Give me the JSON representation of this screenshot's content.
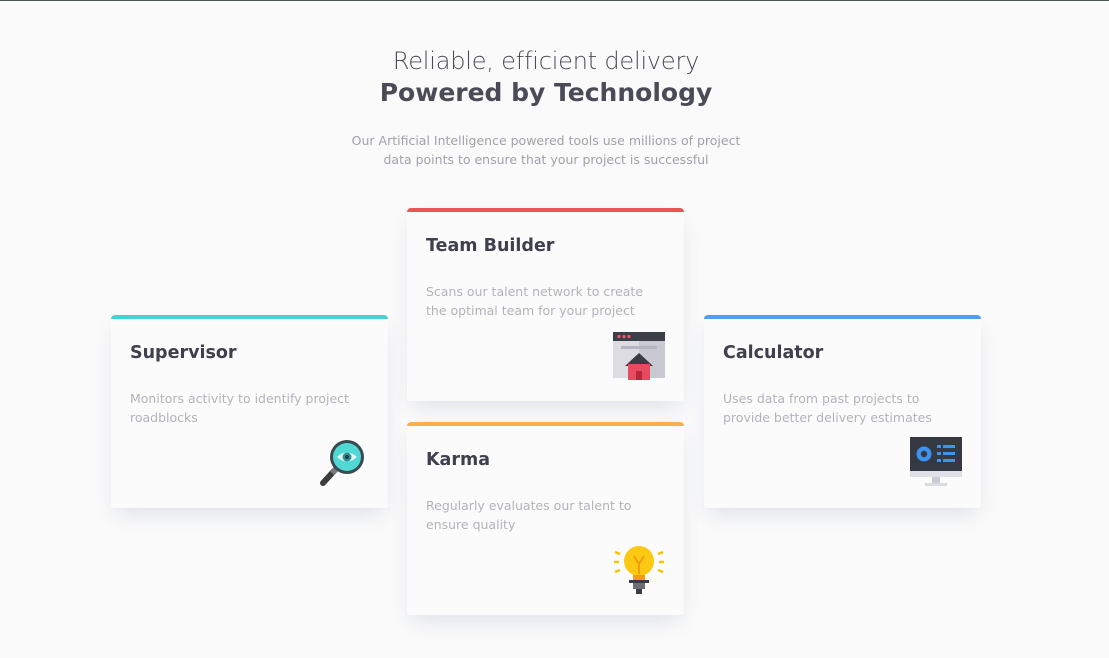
{
  "header": {
    "subtitle": "Reliable, efficient delivery",
    "title": "Powered by Technology",
    "intro": "Our Artificial Intelligence powered tools use millions of project data points to ensure that your project is successful"
  },
  "cards": [
    {
      "title": "Supervisor",
      "description": "Monitors activity to identify project roadblocks",
      "accent": "#44d3d2",
      "icon": "magnifier-eye-icon"
    },
    {
      "title": "Team Builder",
      "description": "Scans our talent network to create the optimal team for your project",
      "accent": "#ea5454",
      "icon": "browser-home-icon"
    },
    {
      "title": "Karma",
      "description": "Regularly evaluates our talent to ensure quality",
      "accent": "#fcaf4a",
      "icon": "lightbulb-icon"
    },
    {
      "title": "Calculator",
      "description": "Uses data from past projects to provide better delivery estimates",
      "accent": "#549ef2",
      "icon": "monitor-dashboard-icon"
    }
  ]
}
